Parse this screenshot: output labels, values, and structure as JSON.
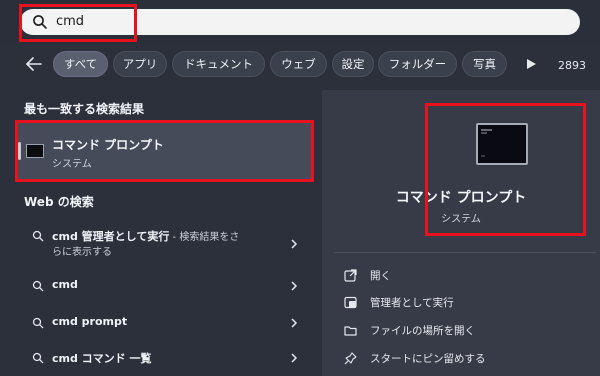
{
  "search": {
    "query": "cmd"
  },
  "filters": {
    "chips": [
      {
        "label": "すべて",
        "active": true
      },
      {
        "label": "アプリ",
        "active": false
      },
      {
        "label": "ドキュメント",
        "active": false
      },
      {
        "label": "ウェブ",
        "active": false
      },
      {
        "label": "設定",
        "active": false
      },
      {
        "label": "フォルダー",
        "active": false
      },
      {
        "label": "写真",
        "active": false
      }
    ],
    "count": "2893"
  },
  "best_match": {
    "heading": "最も一致する検索結果",
    "name": "コマンド プロンプト",
    "type": "システム"
  },
  "web": {
    "heading": "Web の検索",
    "items": [
      {
        "bold": "cmd 管理者として実行",
        "tail": " - 検索結果をさ",
        "line2": "らに表示する"
      },
      {
        "bold": "cmd",
        "tail": "",
        "line2": ""
      },
      {
        "bold": "cmd prompt",
        "tail": "",
        "line2": ""
      },
      {
        "bold": "cmd コマンド 一覧",
        "tail": "",
        "line2": ""
      }
    ]
  },
  "preview": {
    "title": "コマンド プロンプト",
    "subtitle": "システム",
    "actions": [
      {
        "label": "開く",
        "icon": "open-icon"
      },
      {
        "label": "管理者として実行",
        "icon": "admin-shield-icon"
      },
      {
        "label": "ファイルの場所を開く",
        "icon": "folder-icon"
      },
      {
        "label": "スタートにピン留めする",
        "icon": "pin-icon"
      }
    ]
  },
  "colors": {
    "highlight": "#e8121e",
    "background": "#2b303b",
    "panel": "#363b47"
  }
}
